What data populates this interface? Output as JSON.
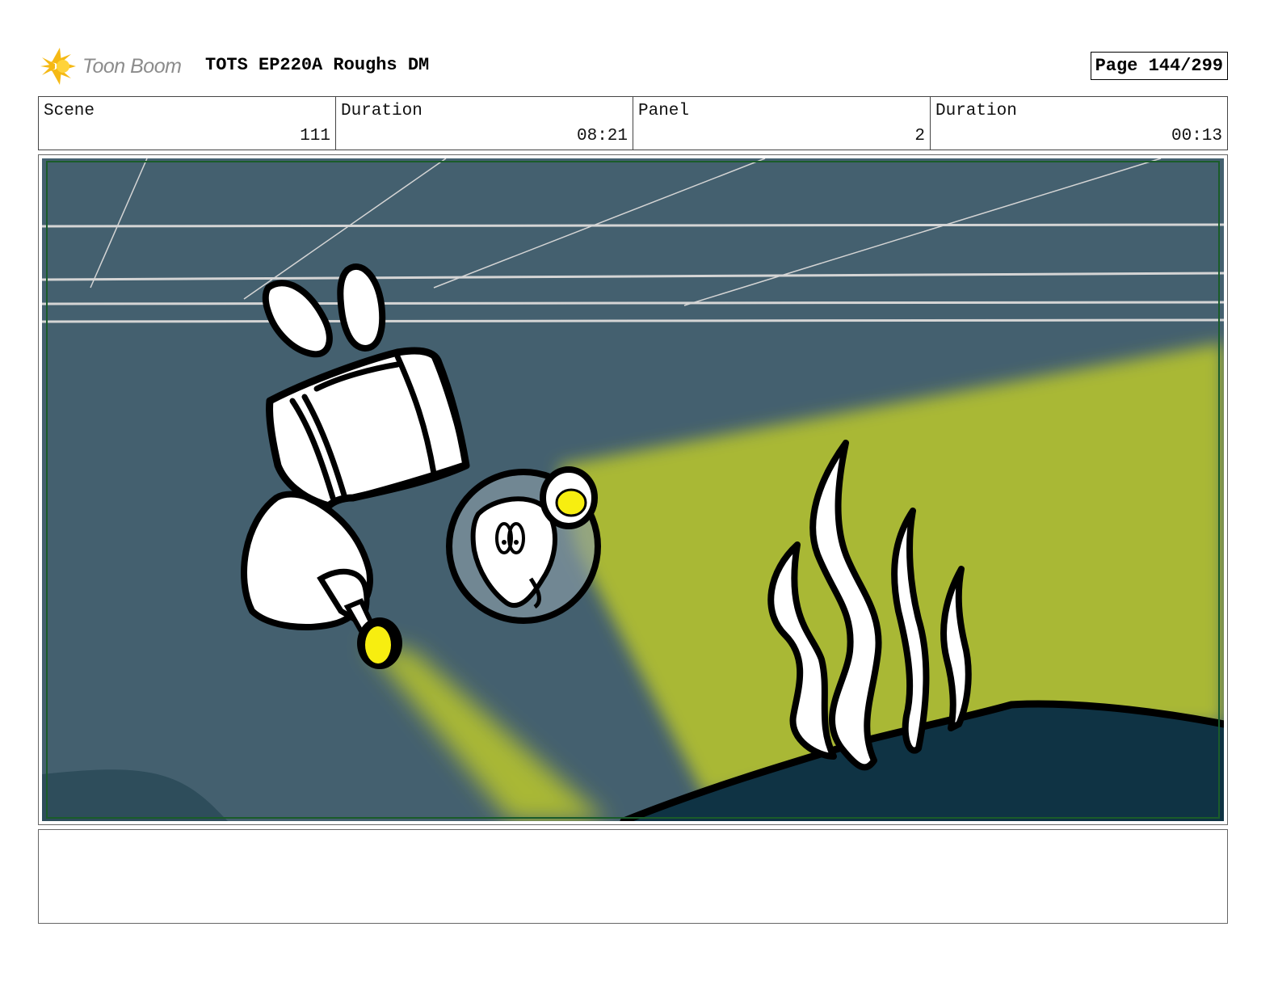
{
  "header": {
    "logo_text": "Toon Boom",
    "title": "TOTS EP220A Roughs DM",
    "page": "Page 144/299"
  },
  "info": {
    "scene_label": "Scene",
    "scene_value": "111",
    "scene_duration_label": "Duration",
    "scene_duration_value": "08:21",
    "panel_label": "Panel",
    "panel_value": "2",
    "panel_duration_label": "Duration",
    "panel_duration_value": "00:13"
  },
  "colors": {
    "water": "#44606f",
    "light_beam": "#a9b835",
    "seafloor": "#0f3344",
    "headlamp": "#f7ee10",
    "frame_green": "#1a5c2a"
  },
  "notes": {
    "text": ""
  }
}
